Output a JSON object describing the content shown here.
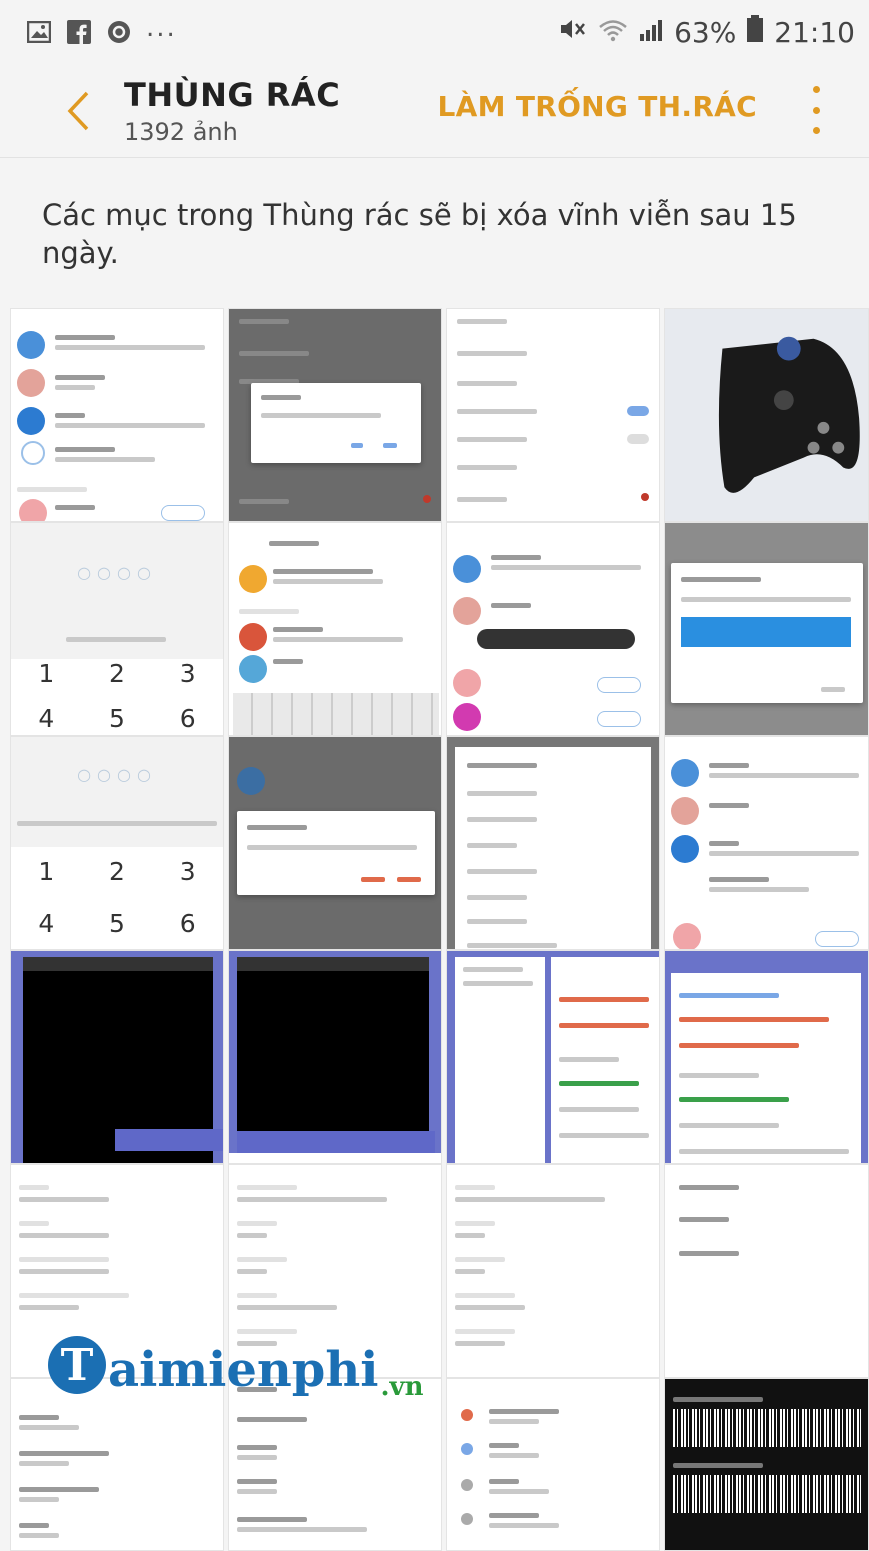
{
  "status_bar": {
    "overflow": "...",
    "battery": "63%",
    "time": "21:10",
    "icons": [
      "image-icon",
      "facebook-icon",
      "messenger-icon",
      "mute-icon",
      "wifi-icon",
      "signal-icon",
      "battery-icon"
    ]
  },
  "header": {
    "title": "THÙNG RÁC",
    "subtitle": "1392 ảnh",
    "empty_button": "LÀM TRỐNG TH.RÁC",
    "accent_color": "#e09a22"
  },
  "notice": "Các mục trong Thùng rác sẽ bị xóa vĩnh viễn sau 15 ngày.",
  "keypad": {
    "row1": [
      "1",
      "2",
      "3"
    ],
    "row2": [
      "4",
      "5",
      "6"
    ]
  },
  "watermark": {
    "initial": "T",
    "text": "aimienphi",
    "suffix": ".vn"
  }
}
